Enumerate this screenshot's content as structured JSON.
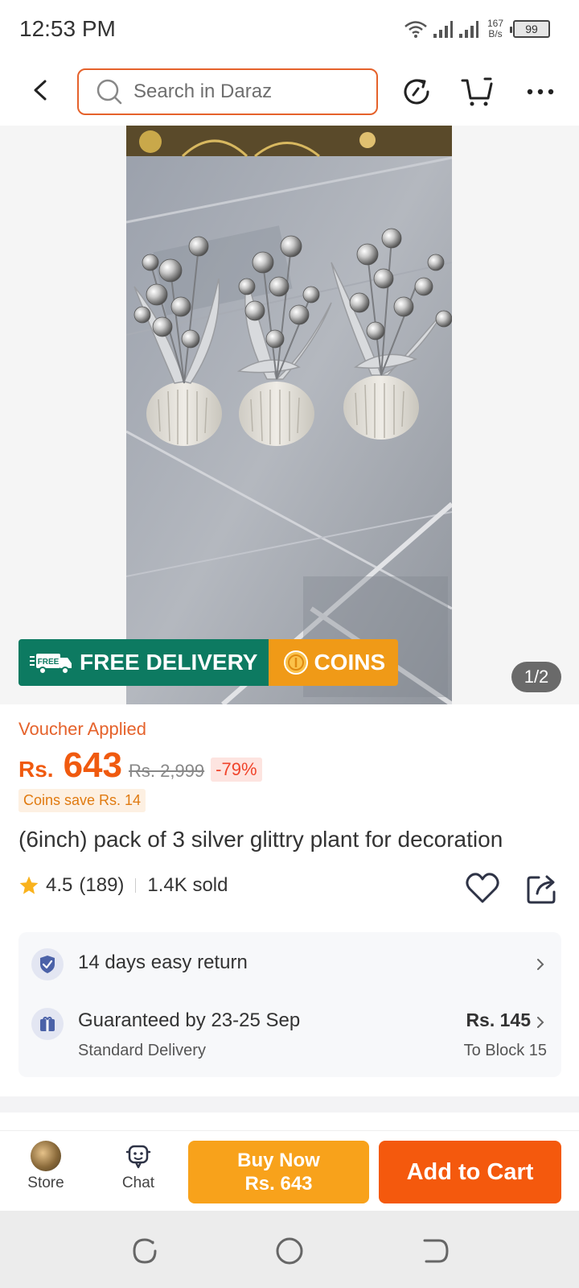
{
  "status_bar": {
    "time": "12:53 PM",
    "net_speed_value": "167",
    "net_speed_unit": "B/s",
    "battery": "99"
  },
  "top_bar": {
    "search_placeholder": "Search in Daraz",
    "icons": [
      "back-icon",
      "search-icon",
      "history-icon",
      "cart-icon",
      "more-icon"
    ]
  },
  "gallery": {
    "promo_free": "FREE DELIVERY",
    "promo_free_tag": "FREE",
    "promo_coins": "COINS",
    "page_indicator": "1/2"
  },
  "pricing": {
    "voucher_label": "Voucher Applied",
    "currency": "Rs.",
    "price": "643",
    "original_price": "Rs. 2,999",
    "discount": "-79%",
    "coins_save": "Coins save Rs. 14"
  },
  "product": {
    "title": "(6inch) pack of 3 silver glittry plant for decoration",
    "rating": "4.5",
    "reviews": "(189)",
    "sold": "1.4K sold"
  },
  "services": {
    "return": "14 days easy return",
    "delivery_guarantee": "Guaranteed by 23-25 Sep",
    "delivery_type": "Standard Delivery",
    "delivery_fee": "Rs. 145",
    "delivery_location": "To Block 15"
  },
  "bottom_bar": {
    "store_label": "Store",
    "chat_label": "Chat",
    "buy_now_label": "Buy Now",
    "buy_now_price": "Rs. 643",
    "add_to_cart_label": "Add to Cart"
  },
  "colors": {
    "accent": "#f4590d",
    "buy_now": "#f8a21b",
    "free_delivery": "#0d7a61",
    "coins": "#f09a17",
    "price": "#f05a0f"
  }
}
